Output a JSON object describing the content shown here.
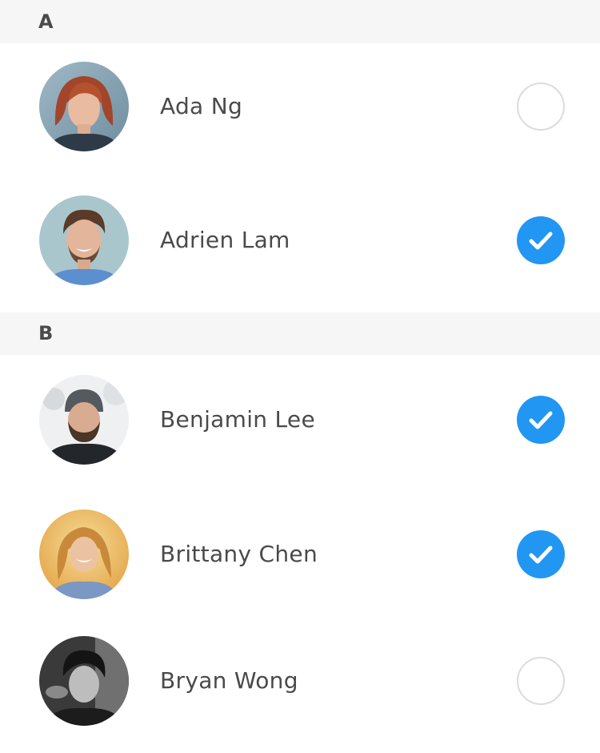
{
  "sections": [
    {
      "letter": "A"
    },
    {
      "letter": "B"
    }
  ],
  "contacts": [
    {
      "name": "Ada Ng",
      "section": "A",
      "selected": false,
      "avatar_icon": "avatar-photo-red-hair-woman"
    },
    {
      "name": "Adrien Lam",
      "section": "A",
      "selected": true,
      "avatar_icon": "avatar-photo-smiling-man"
    },
    {
      "name": "Benjamin Lee",
      "section": "B",
      "selected": true,
      "avatar_icon": "avatar-photo-man-beanie"
    },
    {
      "name": "Brittany Chen",
      "section": "B",
      "selected": true,
      "avatar_icon": "avatar-photo-blonde-woman"
    },
    {
      "name": "Bryan Wong",
      "section": "B",
      "selected": false,
      "avatar_icon": "avatar-photo-bw-man"
    }
  ],
  "colors": {
    "accent": "#2196f3",
    "section_bg": "#f6f6f6",
    "text": "#4a4a4a",
    "unchecked_border": "#dcdcdc"
  }
}
